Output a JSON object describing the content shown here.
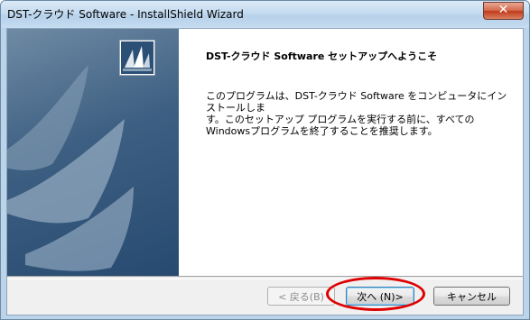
{
  "window": {
    "title": "DST-クラウド Software - InstallShield Wizard",
    "close_label": "✕"
  },
  "welcome": {
    "heading": "DST-クラウド Software セットアップへようこそ",
    "description": "このプログラムは、DST-クラウド Software をコンピュータにインストールしま\nす。このセットアップ プログラムを実行する前に、すべての\nWindowsプログラムを終了することを推奨します。"
  },
  "buttons": {
    "back": "< 戻る(B)",
    "next": "次へ (N)>",
    "cancel": "キャンセル"
  },
  "icons": {
    "app_icon": "installshield-sail-icon",
    "close_icon": "close-icon"
  },
  "colors": {
    "highlight": "#e00000",
    "left_panel": "#3d5f82"
  }
}
